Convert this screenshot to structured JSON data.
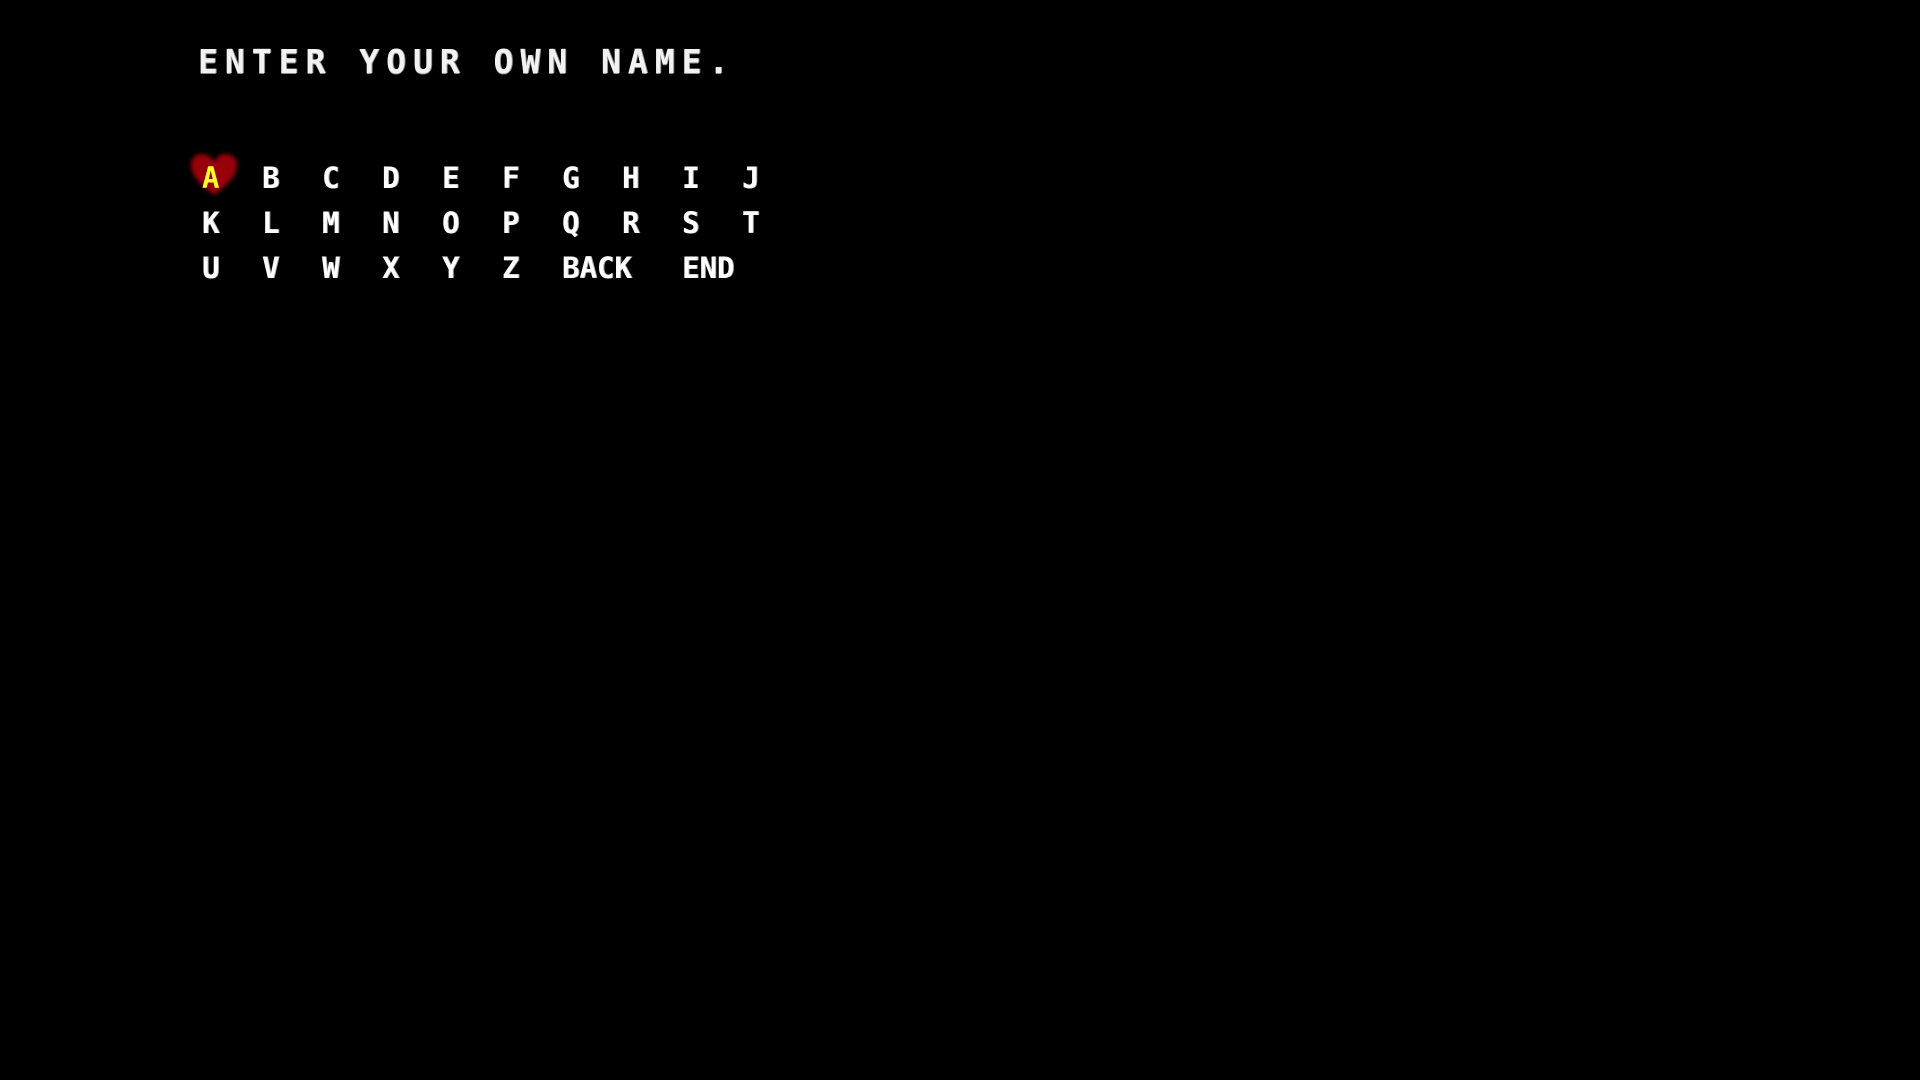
{
  "prompt": "ENTER YOUR OWN NAME.",
  "selected_key": "A",
  "keyboard": {
    "row1": [
      "A",
      "B",
      "C",
      "D",
      "E",
      "F",
      "G",
      "H",
      "I",
      "J"
    ],
    "row2": [
      "K",
      "L",
      "M",
      "N",
      "O",
      "P",
      "Q",
      "R",
      "S",
      "T"
    ],
    "row3": [
      "U",
      "V",
      "W",
      "X",
      "Y",
      "Z"
    ],
    "back_label": "BACK",
    "end_label": "END"
  },
  "colors": {
    "background": "#000000",
    "text": "#ffffff",
    "selected_text": "#ffff2a",
    "heart": "#b3000c"
  },
  "icons": {
    "selection_cursor": "heart-icon"
  }
}
